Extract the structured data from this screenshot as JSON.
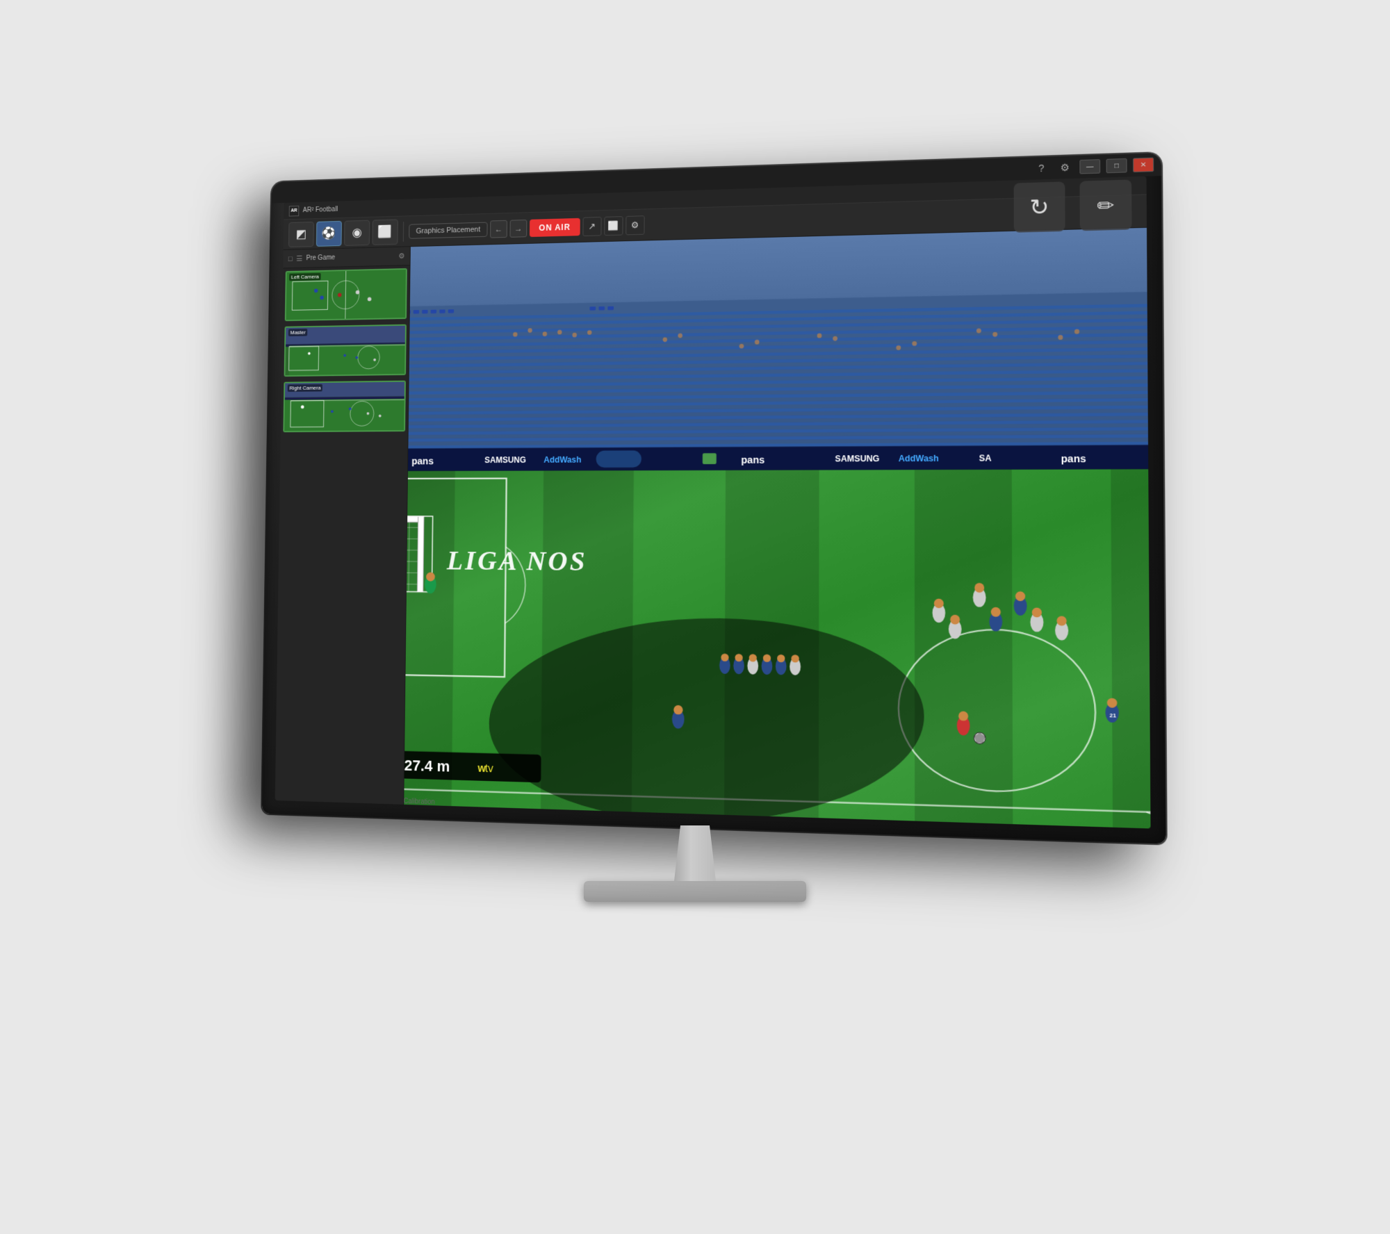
{
  "window": {
    "title": "AR² Football",
    "buttons": {
      "minimize": "—",
      "maximize": "□",
      "close": "✕"
    }
  },
  "titlebar": {
    "icons": [
      "?",
      "⚙"
    ]
  },
  "large_buttons": {
    "refresh_label": "↻",
    "eyedropper_label": "✏"
  },
  "toolbar": {
    "graphics_placement": "Graphics Placement",
    "nav_back": "←",
    "nav_forward": "→",
    "on_air": "ON AIR",
    "arrow_icon": "↗",
    "camera_icon": "⬜",
    "settings_icon": "⚙"
  },
  "sidebar": {
    "header_text": "Pre Game",
    "icons": [
      "□",
      "☰",
      "⚙"
    ],
    "cameras": [
      {
        "label": "Left Camera",
        "id": "left-camera"
      },
      {
        "label": "Master",
        "id": "master-camera"
      },
      {
        "label": "Right Camera",
        "id": "right-camera"
      }
    ]
  },
  "main_view": {
    "sponsor_texts": [
      "pans",
      "SAMSUNG AddWash",
      "pans",
      "SAMSUNG AddWash",
      "SA"
    ],
    "liga_text": "LIGA NOS",
    "distance": "27.4 m",
    "wtv": "wtv",
    "camera_calibration": "Camera Calibration"
  },
  "toolbar_tabs": [
    {
      "id": "checkerboard",
      "icon": "◩"
    },
    {
      "id": "players",
      "icon": "⚽"
    },
    {
      "id": "dial",
      "icon": "◎"
    },
    {
      "id": "field",
      "icon": "⬜"
    }
  ],
  "colors": {
    "on_air_bg": "#e83030",
    "active_tab": "#3a5a8a",
    "field_green": "#3a9a3a",
    "stand_blue": "#4a6a9a",
    "sponsor_navy": "#1a1a4a"
  }
}
